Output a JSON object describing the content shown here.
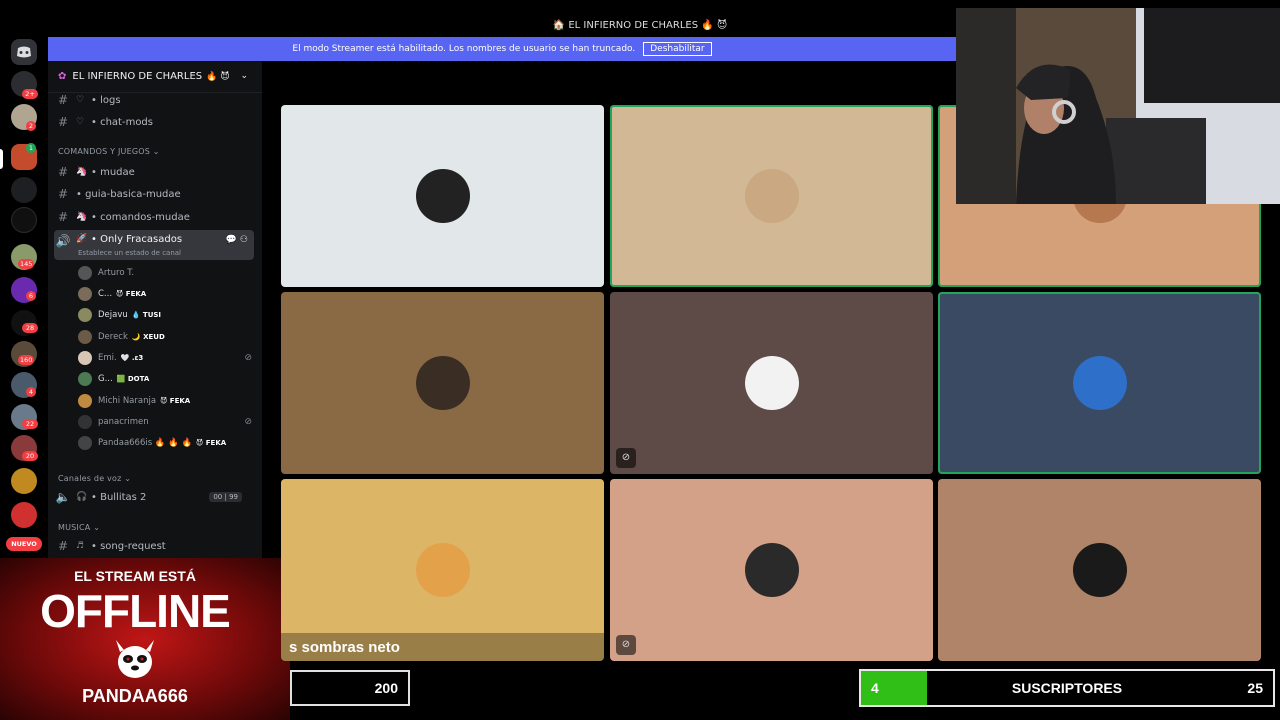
{
  "window": {
    "title": "🏠 EL INFIERNO DE CHARLES 🔥 😈"
  },
  "banner": {
    "text": "El modo Streamer está habilitado. Los nombres de usuario se han truncado.",
    "button": "Deshabilitar"
  },
  "rail": {
    "badges": [
      "2+",
      "2",
      "1",
      "145",
      "6",
      "28",
      "160",
      "4",
      "22",
      "20"
    ],
    "nuevo": "NUEVO"
  },
  "server": {
    "name": "EL INFIERNO DE CHARLES",
    "emoji": "🔥 😈"
  },
  "channels": {
    "top": [
      "logs",
      "chat-mods"
    ],
    "cat_games": "COMANDOS Y JUEGOS",
    "games": [
      "mudae",
      "guia-basica-mudae",
      "comandos-mudae"
    ],
    "voice_active": {
      "name": "Only Fracasados",
      "status": "Establece un estado de canal"
    },
    "cat_voice": "Canales de voz",
    "voice2": {
      "name": "Bullitas 2",
      "count_a": "00",
      "count_b": "99"
    },
    "cat_music": "MUSICA",
    "music": [
      "song-request"
    ]
  },
  "voice_users": [
    {
      "name": "Arturo T.",
      "tag": "",
      "dim": true,
      "color": "#555"
    },
    {
      "name": "C...",
      "tag": "😈 FEKA",
      "dim": false,
      "color": "#7a6b5b"
    },
    {
      "name": "Dejavu",
      "tag": "💧 TUSI",
      "dim": false,
      "color": "#8a8a60"
    },
    {
      "name": "Dereck",
      "tag": "🌙 XEUD",
      "dim": true,
      "color": "#6b5a48"
    },
    {
      "name": "Emi.",
      "tag": "🤍 .ε3",
      "dim": true,
      "color": "#d9c7b5"
    },
    {
      "name": "G...",
      "tag": "🟩 DOTA",
      "dim": false,
      "color": "#4b7a55"
    },
    {
      "name": "Michi Naranja",
      "tag": "😈 FEKA",
      "dim": true,
      "color": "#c08a40"
    },
    {
      "name": "panacrimen",
      "tag": "",
      "dim": true,
      "color": "#333"
    },
    {
      "name": "Pandaa666is 🔥 🔥 🔥",
      "tag": "😈 FEKA",
      "dim": true,
      "color": "#444"
    }
  ],
  "offline": {
    "line1": "EL STREAM ESTÁ",
    "line2": "OFFLINE",
    "line3": "PANDAA666"
  },
  "tiles": [
    {
      "bg": "#e2e7ea",
      "av": "#222",
      "speaking": false,
      "mute": false,
      "caption": ""
    },
    {
      "bg": "#d3b896",
      "av": "#c9a882",
      "speaking": true,
      "mute": false,
      "caption": ""
    },
    {
      "bg": "#d4a07a",
      "av": "#b5784f",
      "speaking": true,
      "mute": false,
      "caption": ""
    },
    {
      "bg": "#8a6a44",
      "av": "#3a2e24",
      "speaking": false,
      "mute": false,
      "caption": ""
    },
    {
      "bg": "#5e4a46",
      "av": "#f2f2f2",
      "speaking": false,
      "mute": true,
      "caption": ""
    },
    {
      "bg": "#3a4a63",
      "av": "#2d6fc9",
      "speaking": true,
      "mute": false,
      "caption": ""
    },
    {
      "bg": "#ddb567",
      "av": "#e3a24a",
      "speaking": false,
      "mute": false,
      "caption": "s sombras neto"
    },
    {
      "bg": "#d3a188",
      "av": "#2a2a2a",
      "speaking": false,
      "mute": true,
      "caption": ""
    },
    {
      "bg": "#b08468",
      "av": "#1a1a1a",
      "speaking": false,
      "mute": false,
      "caption": ""
    }
  ],
  "counter_left": "200",
  "subs": {
    "current": "4",
    "label": "SUSCRIPTORES",
    "goal": "25",
    "progress": 0.16
  },
  "colors": {
    "accent": "#5865f2",
    "speaking": "#23a559",
    "sub_fill": "#2fbf16"
  }
}
